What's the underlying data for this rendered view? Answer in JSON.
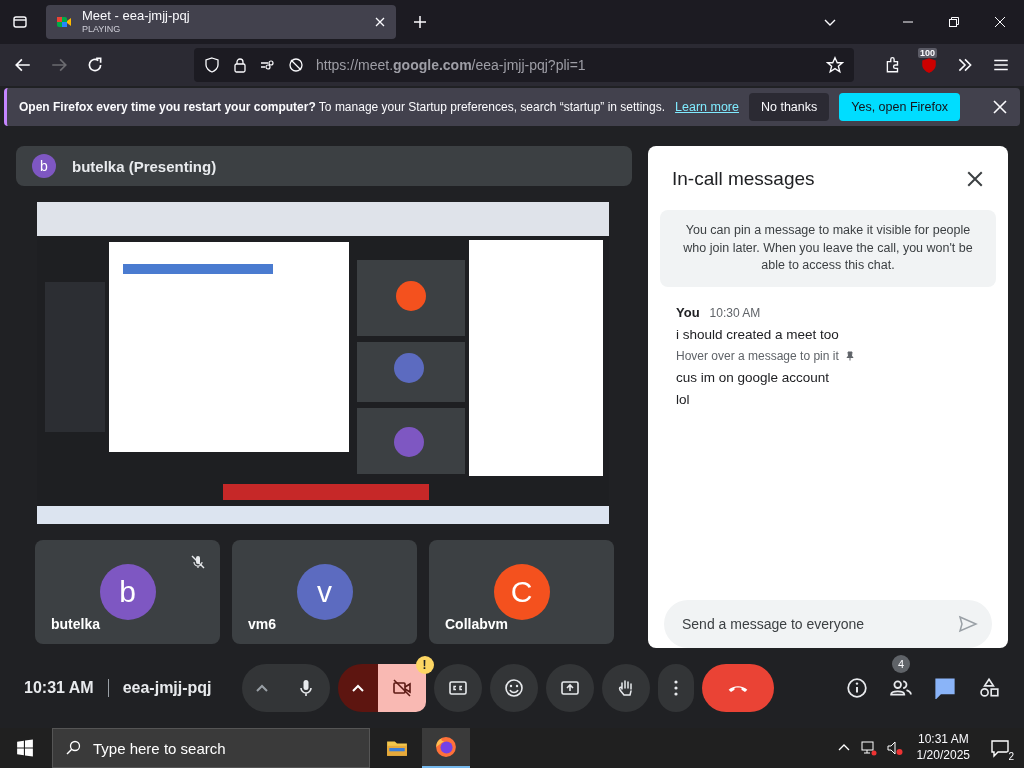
{
  "browser": {
    "tab": {
      "title": "Meet - eea-jmjj-pqj",
      "subtitle": "PLAYING",
      "selected": true
    },
    "url": "https://meet.**google.com**/eea-jmjj-pqj?pli=1",
    "extension_badge": "100"
  },
  "notification": {
    "text": "**Open Firefox every time you restart your computer?** To manage your Startup preferences, search “startup” in settings.",
    "link": "Learn more",
    "buttons": [
      {
        "label": "No thanks",
        "kind": "secondary"
      },
      {
        "label": "Yes, open Firefox",
        "kind": "primary"
      }
    ]
  },
  "presenter": {
    "initial": "b",
    "name": "butelka (Presenting)",
    "color": "#7e57c2"
  },
  "tiles": [
    {
      "initial": "b",
      "name": "butelka",
      "color": "#7e57c2",
      "muted": true
    },
    {
      "initial": "v",
      "name": "vm6",
      "color": "#5c6bc0",
      "muted": false
    },
    {
      "initial": "C",
      "name": "Collabvm",
      "color": "#f4511e",
      "muted": false
    }
  ],
  "chat": {
    "title": "In-call messages",
    "notice": "You can pin a message to make it visible for people who join later. When you leave the call, you won't be able to access this chat.",
    "sender": "You",
    "time": "10:30 AM",
    "messages": [
      "i should created a meet too",
      "cus im on google account",
      "lol"
    ],
    "hint": "Hover over a message to pin it",
    "placeholder": "Send a message to everyone"
  },
  "call_bar": {
    "time": "10:31 AM",
    "meeting_code": "eea-jmjj-pqj",
    "mic_on": true,
    "camera_on": false,
    "camera_warning": "!",
    "people_count": "4",
    "chat_selected": true
  },
  "taskbar": {
    "search_placeholder": "Type here to search",
    "time": "10:31 AM",
    "date": "1/20/2025",
    "notifications": "2"
  }
}
